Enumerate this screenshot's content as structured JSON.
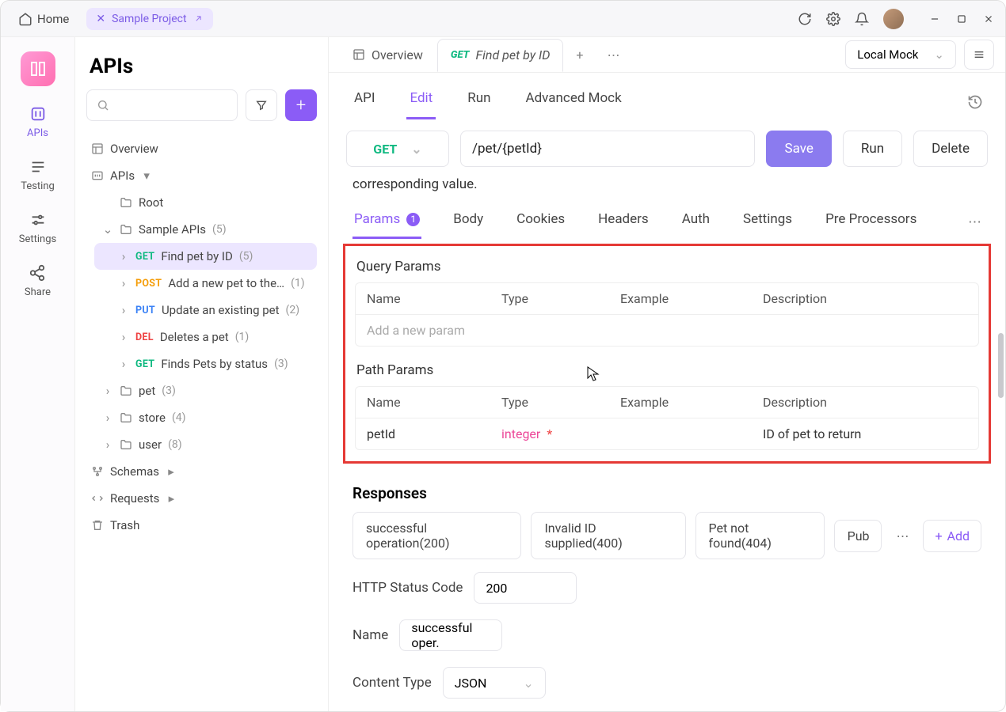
{
  "titlebar": {
    "home": "Home",
    "project_tab": "Sample Project"
  },
  "rail": {
    "apis": "APIs",
    "testing": "Testing",
    "settings": "Settings",
    "share": "Share"
  },
  "sidebar": {
    "title": "APIs",
    "overview": "Overview",
    "apis_label": "APIs",
    "schemas": "Schemas",
    "requests": "Requests",
    "trash": "Trash",
    "tree": {
      "root": "Root",
      "sample_apis": {
        "label": "Sample APIs",
        "count": "(5)"
      },
      "endpoints": [
        {
          "method": "GET",
          "name": "Find pet by ID",
          "count": "(5)",
          "cls": "m-get",
          "selected": true
        },
        {
          "method": "POST",
          "name": "Add a new pet to the…",
          "count": "(1)",
          "cls": "m-post",
          "selected": false
        },
        {
          "method": "PUT",
          "name": "Update an existing pet",
          "count": "(2)",
          "cls": "m-put",
          "selected": false
        },
        {
          "method": "DEL",
          "name": "Deletes a pet",
          "count": "(1)",
          "cls": "m-del",
          "selected": false
        },
        {
          "method": "GET",
          "name": "Finds Pets by status",
          "count": "(3)",
          "cls": "m-get",
          "selected": false
        }
      ],
      "folders": [
        {
          "name": "pet",
          "count": "(3)"
        },
        {
          "name": "store",
          "count": "(4)"
        },
        {
          "name": "user",
          "count": "(8)"
        }
      ]
    }
  },
  "tabs": {
    "overview": "Overview",
    "current": {
      "method": "GET",
      "title": "Find pet by ID"
    },
    "env": "Local Mock"
  },
  "subtabs": {
    "api": "API",
    "edit": "Edit",
    "run": "Run",
    "mock": "Advanced Mock"
  },
  "request": {
    "method": "GET",
    "url": "/pet/{petId}",
    "save": "Save",
    "run": "Run",
    "delete": "Delete",
    "desc": "corresponding value."
  },
  "param_tabs": {
    "params": "Params",
    "params_count": "1",
    "body": "Body",
    "cookies": "Cookies",
    "headers": "Headers",
    "auth": "Auth",
    "settings": "Settings",
    "pre": "Pre Processors"
  },
  "params_section": {
    "query_title": "Query Params",
    "path_title": "Path Params",
    "cols": {
      "name": "Name",
      "type": "Type",
      "example": "Example",
      "description": "Description"
    },
    "add_placeholder": "Add a new param",
    "path_row": {
      "name": "petId",
      "type": "integer",
      "description": "ID of pet to return"
    }
  },
  "responses": {
    "title": "Responses",
    "tabs": [
      "successful operation(200)",
      "Invalid ID supplied(400)",
      "Pet not found(404)",
      "Pub"
    ],
    "add": "Add",
    "http_label": "HTTP Status Code",
    "http_value": "200",
    "name_label": "Name",
    "name_value": "successful oper.",
    "ct_label": "Content Type",
    "ct_value": "JSON"
  }
}
